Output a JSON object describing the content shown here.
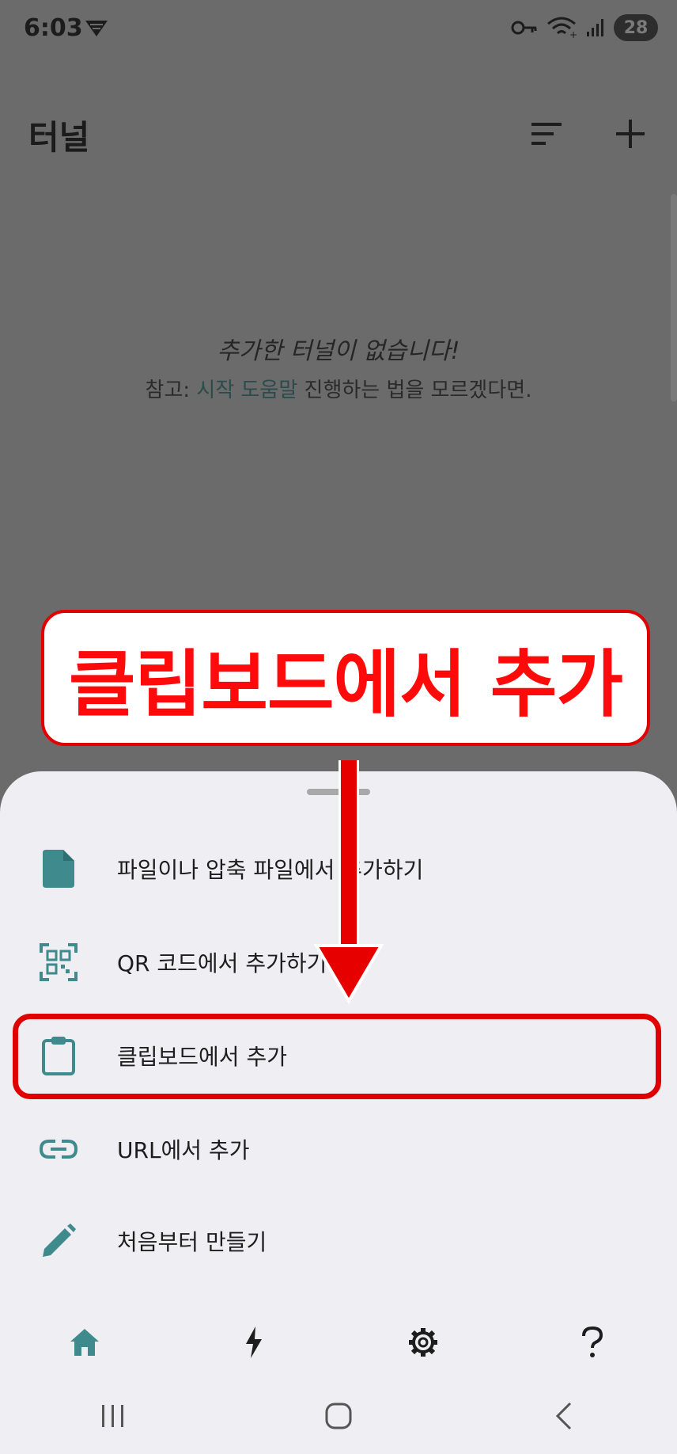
{
  "status_bar": {
    "time": "6:03",
    "battery": "28",
    "icons": [
      "signal-app-icon",
      "vpn-key-icon",
      "wifi-icon",
      "cell-signal-icon",
      "battery-icon"
    ]
  },
  "app_bar": {
    "title": "터널",
    "actions": [
      "sort-icon",
      "add-icon"
    ]
  },
  "empty_state": {
    "message": "추가한 터널이 없습니다!",
    "note_prefix": "참고: ",
    "note_link": "시작 도움말",
    "note_suffix": " 진행하는 법을 모르겠다면."
  },
  "annotation": {
    "callout_text": "클립보드에서 추가"
  },
  "sheet": {
    "items": [
      {
        "label": "파일이나 압축 파일에서 추가하기",
        "icon": "file-icon"
      },
      {
        "label": "QR 코드에서 추가하기",
        "icon": "qr-code-icon"
      },
      {
        "label": "클립보드에서 추가",
        "icon": "clipboard-icon"
      },
      {
        "label": "URL에서 추가",
        "icon": "link-icon"
      },
      {
        "label": "처음부터 만들기",
        "icon": "pencil-icon"
      }
    ]
  },
  "bottom_nav": [
    "home-icon",
    "bolt-icon",
    "settings-gear-icon",
    "help-icon"
  ],
  "colors": {
    "accent": "#3f8a8c",
    "annotation": "#e30000",
    "sheet": "#efeff3",
    "scrim": "#6b6b6b"
  }
}
